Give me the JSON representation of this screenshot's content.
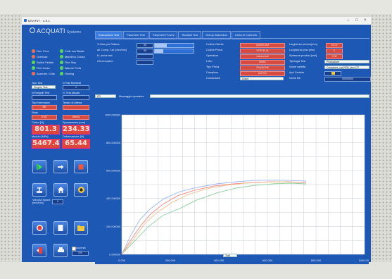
{
  "window": {
    "title": "DNAT07 - 2.0.1",
    "controls": {
      "minimize": "–",
      "maximize": "□",
      "close": "×"
    }
  },
  "brand": {
    "name": "ACQUATI",
    "sub": "Systems"
  },
  "tabs": [
    {
      "label": "Esecuzione Test",
      "active": true
    },
    {
      "label": "Parametri Test",
      "active": false
    },
    {
      "label": "Parametri Provini",
      "active": false
    },
    {
      "label": "Risultati Test",
      "active": false
    },
    {
      "label": "Set-Up Macchina",
      "active": false
    },
    {
      "label": "Carta di Controllo",
      "active": false
    }
  ],
  "status_lamps": [
    {
      "label": "Gen. Error",
      "color": "red"
    },
    {
      "label": "Celle non Bicate",
      "color": "green"
    },
    {
      "label": "Overload",
      "color": "red"
    },
    {
      "label": "Mandrino Chiuso",
      "color": "green"
    },
    {
      "label": "Switch Pedale",
      "color": "green"
    },
    {
      "label": "Fine Stop",
      "color": "green"
    },
    {
      "label": "Fine Corsa",
      "color": "green"
    },
    {
      "label": "Allarme Porta",
      "color": "green"
    },
    {
      "label": "Azzeram. Cella",
      "color": "red"
    },
    {
      "label": "Homing",
      "color": "green"
    }
  ],
  "left_panel": {
    "tipo_test_label": "Tipo Test",
    "tipo_test_value": "Singolo Test",
    "n_test_label": "N Test Richiesti",
    "n_test_value": "1",
    "n_eseguiti_label": "N Eseguiti Test",
    "n_eseguiti_value": "",
    "n_test_attuale_label": "N. Test Attuale",
    "n_test_attuale_value": "",
    "tipo_normativa_label": "Tipo Normativa",
    "tipo_normativa_value": "BR",
    "tempo_label": "Tempo di Attesa",
    "tempo_value": "",
    "stato_label": "Stato",
    "stato_value": "STAT",
    "stato_right_value": "Attesa",
    "carico_label": "Carico [N]",
    "carico_value": "801.3",
    "spost_label": "Spostamento [mm]",
    "spost_value": "234.33",
    "mod_label": "Modulo [MPa]",
    "mod_value": "5467.4",
    "def_label": "Deformazione [%]",
    "def_value": "65.44",
    "speed_label": "Velocità Speed",
    "speed_label2": "[mm/min]",
    "speed_value": "0",
    "print_label": "Accendi",
    "print_value": "0%"
  },
  "middle_params": [
    {
      "label": "% Max per Rottura",
      "value": "55"
    },
    {
      "label": "all. Comp. Car. [mm/min]",
      "value": "55"
    },
    {
      "label": "N. prova test",
      "value": ""
    },
    {
      "label": "Ord.recupero",
      "value": ""
    }
  ],
  "right_params_a": [
    {
      "label": "Codice Cliente",
      "value": "Cliente-test"
    },
    {
      "label": "Codice Prova",
      "value": "VTPCR-31"
    },
    {
      "label": "Operatore",
      "value": "marco-test"
    },
    {
      "label": "Lotto",
      "value": "00001"
    },
    {
      "label": "Tipo Prova",
      "value": "TRAZIONE"
    },
    {
      "label": "Campione",
      "value": "AUTO1"
    },
    {
      "label": "Conduzione",
      "value": "Dolce"
    }
  ],
  "right_params_b": [
    {
      "label": "Larghezza provino[mm]",
      "value": "25.00"
    },
    {
      "label": "Lunghezza prov.[mm]",
      "value": "0"
    },
    {
      "label": "Spessore provino [mm]",
      "value": "0.00"
    },
    {
      "label": "Tipologia Test",
      "value": "Produzione"
    },
    {
      "label": "Nome cartella",
      "value": "Campione_rpp7000_lacc172"
    },
    {
      "label": "Apri Cartella",
      "value": ""
    },
    {
      "label": "Nome file",
      "value": "00000000"
    }
  ],
  "message": {
    "select_value": "PR",
    "label": "Messaggio operatore",
    "value": ""
  },
  "zoom": {
    "value": "Tutti"
  },
  "chart_data": {
    "type": "line",
    "title": "",
    "xlabel": "",
    "ylabel": "",
    "xlim": [
      0,
      1000
    ],
    "ylim": [
      0,
      1000
    ],
    "x_ticks": [
      "0.000",
      "200.000",
      "400.000",
      "600.000",
      "800.000",
      "1000.000"
    ],
    "y_ticks": [
      "0.000000",
      "200.000000",
      "400.000000",
      "600.000000",
      "800.000000",
      "1000.000000"
    ],
    "grid": true,
    "series": [
      {
        "color": "#f28a8a",
        "x": [
          0,
          40,
          80,
          120,
          170,
          230,
          300,
          380,
          460,
          540,
          610,
          680,
          760
        ],
        "y": [
          0,
          110,
          210,
          290,
          360,
          420,
          460,
          490,
          505,
          515,
          520,
          520,
          515
        ]
      },
      {
        "color": "#8fd0a0",
        "x": [
          0,
          50,
          110,
          170,
          240,
          310,
          390,
          470,
          550,
          620,
          690,
          760
        ],
        "y": [
          0,
          90,
          200,
          280,
          330,
          390,
          440,
          475,
          495,
          505,
          510,
          505
        ]
      },
      {
        "color": "#9fb8f0",
        "x": [
          0,
          35,
          75,
          120,
          175,
          240,
          310,
          390,
          470,
          550,
          620,
          690,
          760
        ],
        "y": [
          0,
          130,
          250,
          330,
          400,
          450,
          480,
          505,
          520,
          530,
          532,
          530,
          525
        ]
      },
      {
        "color": "#f0c090",
        "x": [
          0,
          45,
          95,
          145,
          205,
          275,
          350,
          430,
          510,
          590,
          660,
          740
        ],
        "y": [
          0,
          100,
          220,
          300,
          370,
          430,
          470,
          495,
          510,
          518,
          520,
          515
        ]
      }
    ]
  }
}
